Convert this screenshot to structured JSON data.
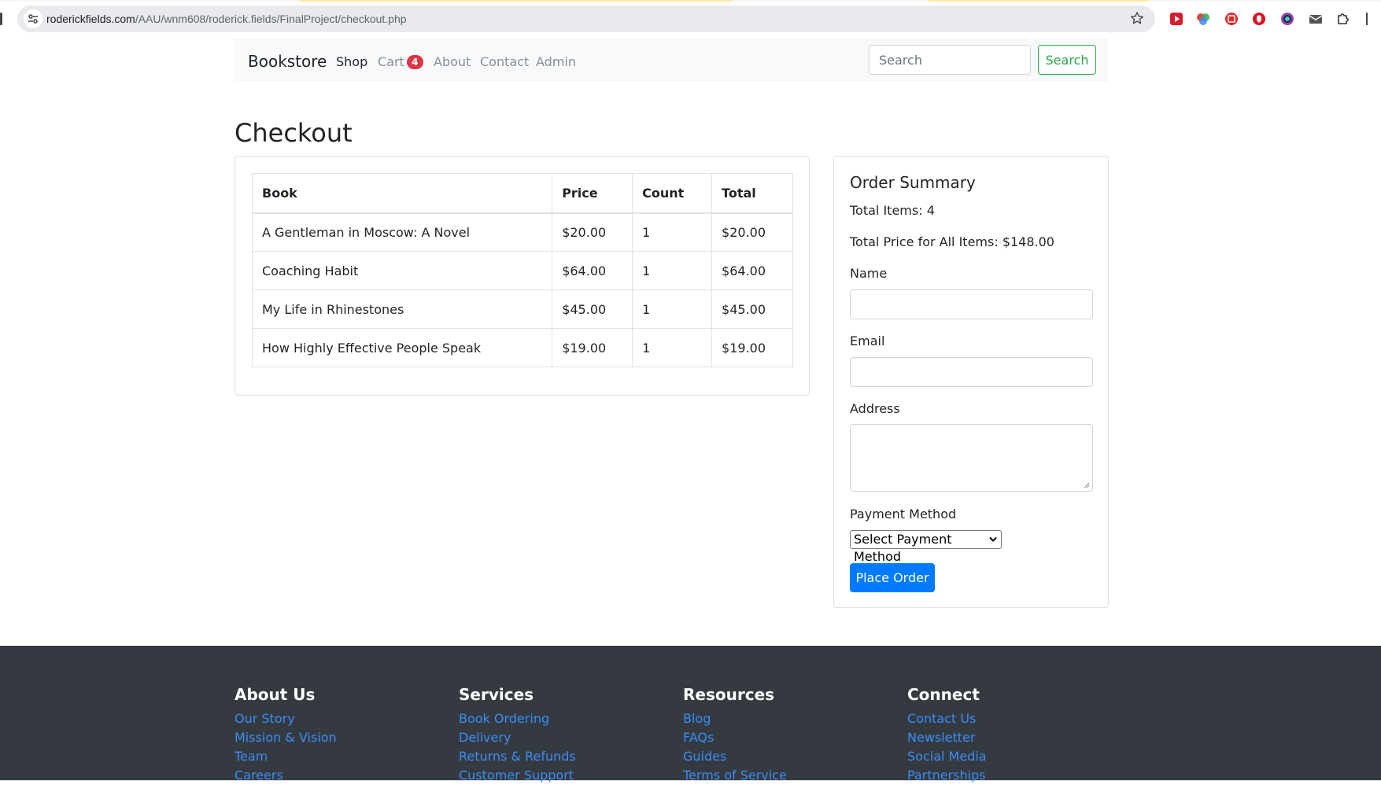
{
  "browser": {
    "url_host": "roderickfields.com",
    "url_path": "/AAU/wnm608/roderick.fields/FinalProject/checkout.php"
  },
  "navbar": {
    "brand": "Bookstore",
    "links": [
      "Shop",
      "Cart",
      "About",
      "Contact",
      "Admin"
    ],
    "cart_count": "4",
    "search_placeholder": "Search",
    "search_button": "Search"
  },
  "page": {
    "title": "Checkout"
  },
  "cart": {
    "headers": [
      "Book",
      "Price",
      "Count",
      "Total"
    ],
    "rows": [
      [
        "A Gentleman in Moscow: A Novel",
        "$20.00",
        "1",
        "$20.00"
      ],
      [
        "Coaching Habit",
        "$64.00",
        "1",
        "$64.00"
      ],
      [
        "My Life in Rhinestones",
        "$45.00",
        "1",
        "$45.00"
      ],
      [
        "How Highly Effective People Speak",
        "$19.00",
        "1",
        "$19.00"
      ]
    ]
  },
  "summary": {
    "title": "Order Summary",
    "total_items": "Total Items: 4",
    "total_price": "Total Price for All Items: $148.00",
    "name_label": "Name",
    "email_label": "Email",
    "address_label": "Address",
    "payment_label": "Payment Method",
    "payment_selected": "Select Payment Method",
    "place_order": "Place Order"
  },
  "footer": {
    "columns": [
      {
        "title": "About Us",
        "links": [
          "Our Story",
          "Mission & Vision",
          "Team",
          "Careers"
        ]
      },
      {
        "title": "Services",
        "links": [
          "Book Ordering",
          "Delivery",
          "Returns & Refunds",
          "Customer Support"
        ]
      },
      {
        "title": "Resources",
        "links": [
          "Blog",
          "FAQs",
          "Guides",
          "Terms of Service"
        ]
      },
      {
        "title": "Connect",
        "links": [
          "Contact Us",
          "Newsletter",
          "Social Media",
          "Partnerships"
        ]
      }
    ]
  },
  "colors": {
    "primary": "#007bff",
    "success": "#28a745",
    "danger": "#dc3545",
    "footer_bg": "#343a40",
    "link": "#3b8cf5"
  }
}
